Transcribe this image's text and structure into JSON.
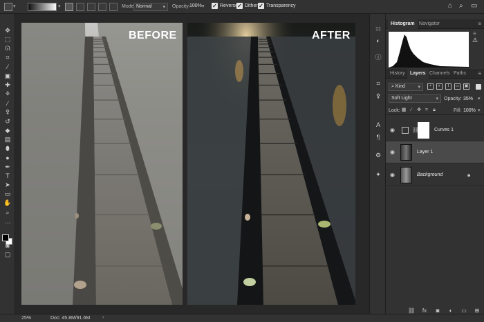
{
  "options_bar": {
    "mode_label": "Mode:",
    "mode_value": "Normal",
    "opacity_label": "Opacity:",
    "opacity_value": "100%",
    "reverse_label": "Reverse",
    "dither_label": "Dither",
    "transparency_label": "Transparency",
    "reverse_checked": true,
    "dither_checked": true,
    "transparency_checked": true,
    "icons": [
      "tool-preset-icon",
      "gradient-linear-icon",
      "gradient-radial-icon",
      "gradient-angle-icon",
      "gradient-reflected-icon",
      "gradient-diamond-icon",
      "home-icon",
      "search-icon",
      "workspace-icon"
    ]
  },
  "toolbar": {
    "tools": [
      {
        "name": "move-tool-icon",
        "glyph": "✥"
      },
      {
        "name": "marquee-tool-icon",
        "glyph": "⬚"
      },
      {
        "name": "lasso-tool-icon",
        "glyph": "ᘏ"
      },
      {
        "name": "crop-tool-icon",
        "glyph": "⌗"
      },
      {
        "name": "eyedropper-tool-icon",
        "glyph": "⁄"
      },
      {
        "name": "frame-tool-icon",
        "glyph": "▣"
      },
      {
        "name": "healing-brush-icon",
        "glyph": "✚"
      },
      {
        "name": "quick-select-icon",
        "glyph": "⚘"
      },
      {
        "name": "brush-tool-icon",
        "glyph": "∕"
      },
      {
        "name": "clone-stamp-icon",
        "glyph": "⚴"
      },
      {
        "name": "history-brush-icon",
        "glyph": "↺"
      },
      {
        "name": "eraser-tool-icon",
        "glyph": "◆"
      },
      {
        "name": "gradient-tool-icon",
        "glyph": "▤"
      },
      {
        "name": "blur-tool-icon",
        "glyph": "⬮"
      },
      {
        "name": "dodge-tool-icon",
        "glyph": "●"
      },
      {
        "name": "pen-tool-icon",
        "glyph": "✒"
      },
      {
        "name": "type-tool-icon",
        "glyph": "T"
      },
      {
        "name": "path-select-icon",
        "glyph": "➤"
      },
      {
        "name": "shape-tool-icon",
        "glyph": "▭"
      },
      {
        "name": "hand-tool-icon",
        "glyph": "✋"
      },
      {
        "name": "zoom-tool-icon",
        "glyph": "⌕"
      },
      {
        "name": "more-tools-icon",
        "glyph": "…"
      },
      {
        "name": "quick-mask-icon",
        "glyph": "◙"
      },
      {
        "name": "screen-mode-icon",
        "glyph": "▢"
      }
    ],
    "foreground_color": "#000000",
    "background_color": "#ffffff"
  },
  "canvas": {
    "before_label": "BEFORE",
    "after_label": "AFTER"
  },
  "status_bar": {
    "zoom": "25%",
    "doc_info": "Doc: 45.8M/91.6M"
  },
  "icon_strip": [
    {
      "name": "libraries-icon",
      "glyph": "⚏"
    },
    {
      "name": "adjustments-icon",
      "glyph": "◐"
    },
    {
      "name": "info-icon",
      "glyph": "ⓘ"
    },
    {
      "name": "brush-settings-icon",
      "glyph": "⌗"
    },
    {
      "name": "clone-source-icon",
      "glyph": "⚴"
    },
    {
      "name": "character-icon",
      "glyph": "A"
    },
    {
      "name": "paragraph-icon",
      "glyph": "¶"
    },
    {
      "name": "properties-icon",
      "glyph": "⚙"
    },
    {
      "name": "learn-icon",
      "glyph": "✦"
    }
  ],
  "panels": {
    "top_tabs": [
      "Histogram",
      "Navigator"
    ],
    "layer_tabs": [
      "History",
      "Layers",
      "Channels",
      "Paths"
    ],
    "kind_label": "Kind",
    "blend_mode": "Soft Light",
    "opacity_label": "Opacity:",
    "opacity_value": "35%",
    "lock_label": "Lock:",
    "fill_label": "Fill:",
    "fill_value": "100%",
    "layers": [
      {
        "name": "Curves 1",
        "type": "adjustment",
        "visible": true,
        "selected": false
      },
      {
        "name": "Layer 1",
        "type": "pixel",
        "visible": true,
        "selected": true
      },
      {
        "name": "Background",
        "type": "background",
        "visible": true,
        "selected": false,
        "locked": true
      }
    ],
    "footer_icons": [
      "link-layers-icon",
      "fx-icon",
      "add-mask-icon",
      "new-adjustment-icon",
      "new-group-icon",
      "new-layer-icon",
      "delete-layer-icon"
    ]
  }
}
